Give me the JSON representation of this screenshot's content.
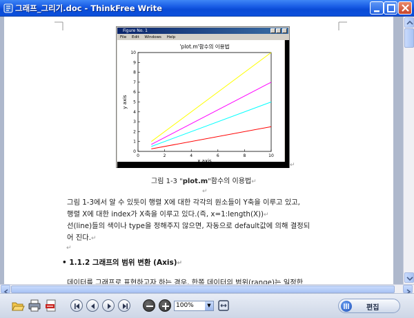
{
  "window": {
    "title": "그래프_그리기.doc - ThinkFree Write",
    "controls": [
      "minimize",
      "maximize",
      "close"
    ]
  },
  "figure_window": {
    "title": "Figure No. 1",
    "menu": [
      "File",
      "Edit",
      "Windows",
      "Help"
    ],
    "chart_data": {
      "type": "line",
      "title": "'plot.m'함수의 이용법",
      "xlabel": "x axis",
      "ylabel": "y axis",
      "xlim": [
        0,
        10
      ],
      "ylim": [
        0,
        10
      ],
      "xticks": [
        "0",
        "2",
        "4",
        "6",
        "8",
        "10"
      ],
      "yticks": [
        "0",
        "1",
        "2",
        "3",
        "4",
        "5",
        "6",
        "7",
        "8",
        "9",
        "10"
      ],
      "grid": false,
      "series": [
        {
          "color": "#ffff00",
          "x": [
            1,
            10
          ],
          "y": [
            1,
            10
          ]
        },
        {
          "color": "#ff00ff",
          "x": [
            1,
            10
          ],
          "y": [
            0.7,
            7
          ]
        },
        {
          "color": "#00ffff",
          "x": [
            1,
            10
          ],
          "y": [
            0.5,
            5
          ]
        },
        {
          "color": "#ff0000",
          "x": [
            1,
            10
          ],
          "y": [
            0.25,
            2.5
          ]
        }
      ]
    }
  },
  "document": {
    "caption_prefix": "그림 1-3 \"",
    "caption_bold": "plot.m",
    "caption_suffix": "\"함수의 이용법",
    "paragraph_lines": [
      "그림 1-3에서 알 수 있듯이 행렬 X에 대한 각각의 원소들이 Y축을 이루고 있고,",
      "행렬 X에 대한 index가 X축을 이루고 있다.(즉, x=1:length(X))",
      "선(line)들의 색이나 type을 정해주지 않으면, 자동으로 default값에 의해 결정되",
      "어 진다."
    ],
    "heading": "• 1.1.2   그래프의 범위 변환 (Axis)",
    "body_line": "데이터를 그래프로 표현하고자 하는 경우, 한쪽 데이터의 범위(range)는 일정한",
    "return_mark": "↵"
  },
  "toolbar": {
    "zoom": "100%",
    "edit_label": "편집",
    "buttons": [
      "open-icon",
      "print-icon",
      "pdf-icon",
      "first-page-icon",
      "prev-page-icon",
      "next-page-icon",
      "last-page-icon",
      "zoom-out-icon",
      "zoom-in-icon",
      "fit-page-icon",
      "edit-icon"
    ]
  }
}
